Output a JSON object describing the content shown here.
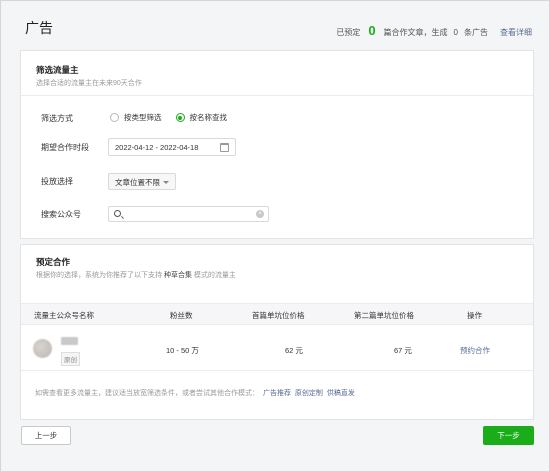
{
  "page": {
    "title": "广告"
  },
  "summary": {
    "prefix": "已预定",
    "count": "0",
    "middle": "篇合作文章，生成",
    "ad_count": "0",
    "suffix": "条广告",
    "detail_link": "查看详细"
  },
  "filter": {
    "title": "筛选流量主",
    "subtitle": "选择合适的流量主在未来90天合作",
    "method_label": "筛选方式",
    "options": [
      "按类型筛选",
      "按名称查找"
    ],
    "selected_option": "按名称查找",
    "period_label": "期望合作时段",
    "period_value": "2022-04-12 - 2022-04-18",
    "placement_label": "投放选择",
    "placement_value": "文章位置不限",
    "search_label": "搜索公众号",
    "search_value": ""
  },
  "recommend": {
    "title": "预定合作",
    "desc_prefix": "根据你的选择，系统为你推荐了以下支持",
    "desc_strong": "种草合集",
    "desc_suffix": "模式的流量主",
    "columns": [
      "流量主公众号名称",
      "粉丝数",
      "首篇单坑位价格",
      "第二篇单坑位价格",
      "操作"
    ],
    "rows": [
      {
        "tag": "原创",
        "fans": "10 - 50 万",
        "first_price": "62 元",
        "second_price": "67 元",
        "action": "预约合作"
      }
    ],
    "note_prefix": "如需查看更多流量主，建议适当放宽筛选条件，或者尝试其他合作模式：",
    "note_links": [
      "广告推荐",
      "原创定制",
      "供稿直发"
    ]
  },
  "buttons": {
    "prev": "上一步",
    "next": "下一步"
  },
  "colors": {
    "accent": "#1aad19",
    "link": "#576b95"
  }
}
